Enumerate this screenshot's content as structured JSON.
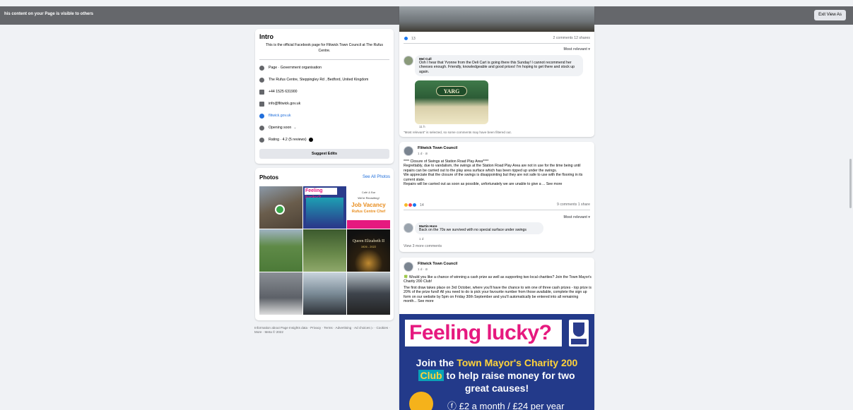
{
  "topbar": {
    "message": "his content on your Page is visible to others",
    "exit_label": "Exit View As"
  },
  "intro": {
    "heading": "Intro",
    "description": "This is the official Facebook page for Flitwick Town Council at The Rufus Centre.",
    "rows": [
      {
        "icon": "info-icon",
        "text": "Page · Government organisation"
      },
      {
        "icon": "location-pin-icon",
        "text": "The Rufus Centre, Steppingley Rd , Bedford, United Kingdom"
      },
      {
        "icon": "phone-icon",
        "text": "+44 1525 631900"
      },
      {
        "icon": "email-icon",
        "text": "info@flitwick.gov.uk"
      },
      {
        "icon": "globe-icon",
        "text": "flitwick.gov.uk"
      },
      {
        "icon": "clock-icon",
        "text": "Opening soon"
      },
      {
        "icon": "star-icon",
        "text": "Rating · 4.2 (5 reviews)"
      }
    ],
    "suggest_label": "Suggest Edits"
  },
  "photos": {
    "heading": "Photos",
    "see_all": "See All Photos",
    "tiles": [
      {
        "name": "photo-event-stalls",
        "color": "#7a6a55"
      },
      {
        "name": "photo-feeling-lucky-poster",
        "color": "#2a3c8c"
      },
      {
        "name": "photo-job-vacancy-poster",
        "color": "#ffffff"
      },
      {
        "name": "photo-sports-field",
        "color": "#5f8a47"
      },
      {
        "name": "photo-park-trees",
        "color": "#5a7a45"
      },
      {
        "name": "photo-queen-elizabeth-candle",
        "color": "#1a1a12"
      },
      {
        "name": "photo-book-signing",
        "color": "#6b6f74"
      },
      {
        "name": "photo-memorial-cross",
        "color": "#7a8a96"
      },
      {
        "name": "photo-ceremony-group",
        "color": "#4a5058"
      }
    ],
    "tile_texts": {
      "lucky": "Feeling lucky?",
      "job_small": "We're Recruiting!",
      "job_title": "Job Vacancy",
      "job_sub": "Rufus Centre Chef",
      "job_cafe": "Café & Bar",
      "queen": "Queen Elizabeth II",
      "queen_years": "1926 - 2022"
    }
  },
  "footer": {
    "text": "Information about Page Insights data · Privacy · Terms · Advertising · Ad choices ▷ · Cookies · More · Meta © 2022"
  },
  "post1": {
    "reaction_count": "13",
    "stats": "2 comments  12 shares",
    "sort_label": "Most relevant ▾",
    "comment": {
      "author": "Mel Cull",
      "text": "Ooh I hear that Yvonne from the Deli Cart is going there this Sunday! I cannot recommend her cheeses enough. Friendly, knowledgeable and good prices! I'm hoping to get there and stock up again.",
      "image_label": "YARG",
      "time": "11 h"
    },
    "filter_note": "\"Most relevant\" is selected, so some comments may have been filtered out."
  },
  "post2": {
    "author": "Flitwick Town Council",
    "time": "1 d · ",
    "text_lines": [
      "**** Closure of Swings at Station Road Play Area****",
      "Regrettably, due to vandalism, the swings at the Station Road Play Area are not in use for the time being until repairs can be carried out to the play area surface which has been ripped up under the swings.",
      "We appreciate that the closure of the swings is disappointing but they are not safe to use with the flooring in its current state.",
      "Repairs will be carried out as soon as possible, unfortunately we are unable to give a ... See more"
    ],
    "reaction_count": "14",
    "stats": "9 comments  1 share",
    "sort_label": "Most relevant ▾",
    "comment": {
      "author": "Martin Hore",
      "text": "Back on the 70s we survived with no special surface under swings",
      "time": "1 d"
    },
    "view_more": "View 3 more comments"
  },
  "post3": {
    "author": "Flitwick Town Council",
    "time": "1 d · ",
    "text_lines": [
      "🍀 Would you like a chance of winning a cash prize as well as supporting two local charities? Join the Town Mayor's Charity 200 Club!",
      "The first draw takes place on 3rd October, where you'll have the chance to win one of three cash prizes - top prize is 20% of the prize fund! All you need to do is pick your favourite number from those available, complete the sign up form on our website by 5pm on Friday 30th September and you'll automatically be entered into all remaining month... See more"
    ],
    "poster": {
      "title": "Feeling lucky?",
      "line1a": "Join the ",
      "line1b": "Town Mayor's Charity 200",
      "line2a": "Club",
      "line2b": " to help raise money for two",
      "line3": "great causes!",
      "price": "ⓕ £2 a month / £24 per year"
    }
  }
}
